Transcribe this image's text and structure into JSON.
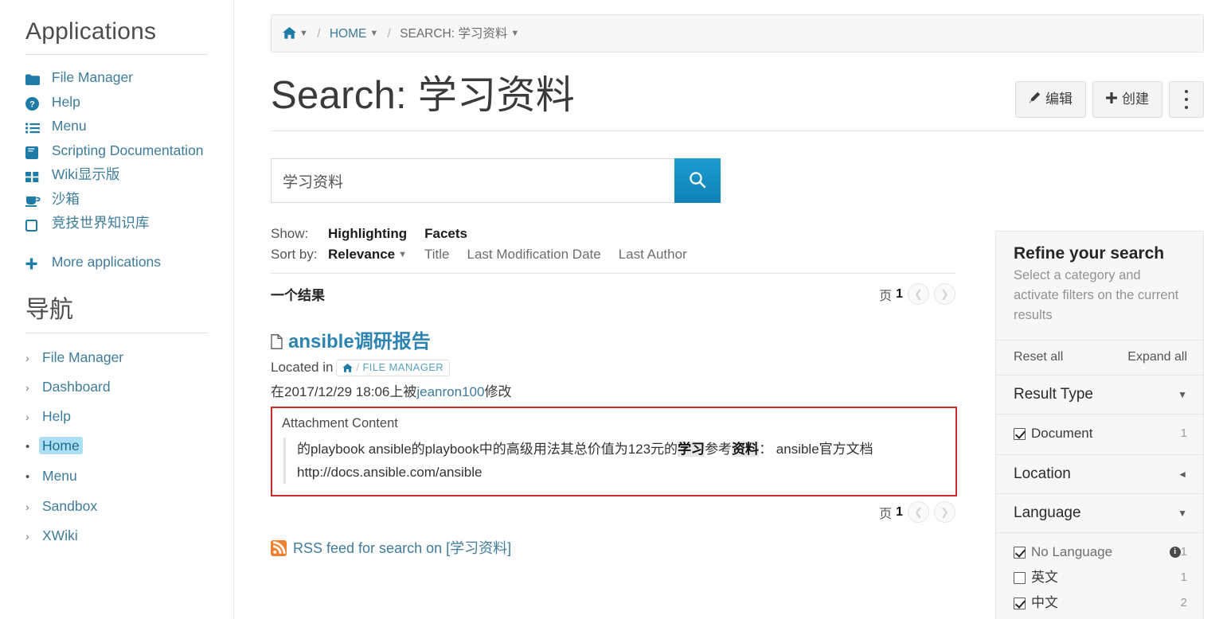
{
  "sidebar": {
    "applications_title": "Applications",
    "apps": [
      {
        "label": "File Manager",
        "icon": "folder-icon"
      },
      {
        "label": "Help",
        "icon": "question-circle-icon"
      },
      {
        "label": "Menu",
        "icon": "list-icon"
      },
      {
        "label": "Scripting Documentation",
        "icon": "book-icon"
      },
      {
        "label": "Wiki显示版",
        "icon": "grid-icon"
      },
      {
        "label": "沙箱",
        "icon": "coffee-icon"
      },
      {
        "label": "竞技世界知识库",
        "icon": "square-icon"
      }
    ],
    "more_applications": "More applications",
    "navigation_title": "导航",
    "nav_items": [
      {
        "label": "File Manager",
        "marker": "chevron",
        "active": false
      },
      {
        "label": "Dashboard",
        "marker": "chevron",
        "active": false
      },
      {
        "label": "Help",
        "marker": "chevron",
        "active": false
      },
      {
        "label": "Home",
        "marker": "dot",
        "active": true
      },
      {
        "label": "Menu",
        "marker": "dot",
        "active": false
      },
      {
        "label": "Sandbox",
        "marker": "chevron",
        "active": false
      },
      {
        "label": "XWiki",
        "marker": "chevron",
        "active": false
      }
    ]
  },
  "breadcrumb": {
    "home_icon": "home-icon",
    "sep": "/",
    "items": [
      {
        "label": "HOME",
        "link": true
      },
      {
        "label": "SEARCH: 学习资料",
        "link": false
      }
    ]
  },
  "header": {
    "title": "Search: 学习资料",
    "buttons": [
      {
        "label": "编辑",
        "icon": "pencil-icon",
        "name": "edit-button"
      },
      {
        "label": "创建",
        "icon": "plus-icon",
        "name": "create-button"
      }
    ],
    "more_menu": "kebab-menu-icon"
  },
  "search": {
    "value": "学习资料",
    "placeholder": "",
    "button_icon": "search-icon"
  },
  "options": {
    "show_label": "Show:",
    "show_items": [
      "Highlighting",
      "Facets"
    ],
    "sort_label": "Sort by:",
    "sort_items": [
      "Relevance",
      "Title",
      "Last Modification Date",
      "Last Author"
    ],
    "sort_selected": "Relevance"
  },
  "results": {
    "count_text": "一个结果",
    "page_label": "页",
    "page_number": "1",
    "prev_icon": "chevron-left-icon",
    "next_icon": "chevron-right-icon",
    "item": {
      "title": "ansible调研报告",
      "doc_icon": "file-icon",
      "located_label": "Located in",
      "located_home_icon": "home-icon",
      "located_sep": "/",
      "located_path": "FILE MANAGER",
      "modified_prefix": "在2017/12/29 18:06上被",
      "modified_author": "jeanron100",
      "modified_suffix": "修改",
      "attachment_label": "Attachment Content",
      "attachment_parts": [
        {
          "text": "的playbook ansible的playbook中的高级用法其总价值为123元的",
          "highlight": false
        },
        {
          "text": "学习",
          "highlight": true
        },
        {
          "text": "参考",
          "highlight": false
        },
        {
          "text": "资料",
          "highlight": true
        },
        {
          "text": "： ansible官方文档 http://docs.ansible.com/ansible",
          "highlight": false
        }
      ]
    },
    "rss_label": "RSS feed for search on [学习资料]",
    "rss_icon": "rss-icon"
  },
  "facets": {
    "title": "Refine your search",
    "subtitle": "Select a category and activate filters on the current results",
    "reset_all": "Reset all",
    "expand_all": "Expand all",
    "groups": [
      {
        "name": "Result Type",
        "caret": "chevron-down-icon",
        "items": [
          {
            "label": "Document",
            "count": "1",
            "checked": true,
            "info": false
          }
        ]
      },
      {
        "name": "Location",
        "caret": "chevron-left-icon",
        "items": []
      },
      {
        "name": "Language",
        "caret": "chevron-down-icon",
        "items": [
          {
            "label": "No Language",
            "count": "1",
            "checked": true,
            "info": true
          },
          {
            "label": "英文",
            "count": "1",
            "checked": false,
            "info": false
          },
          {
            "label": "中文",
            "count": "2",
            "checked": true,
            "info": false
          }
        ]
      }
    ]
  },
  "colors": {
    "link": "#3e7c9b",
    "icon_blue": "#1e7ba6",
    "accent_blue": "#2d84b0",
    "search_button": "#0f82b5",
    "highlight_box_border": "#cc2b2b",
    "active_nav_bg": "#addff4",
    "rss_orange": "#ee802f"
  }
}
